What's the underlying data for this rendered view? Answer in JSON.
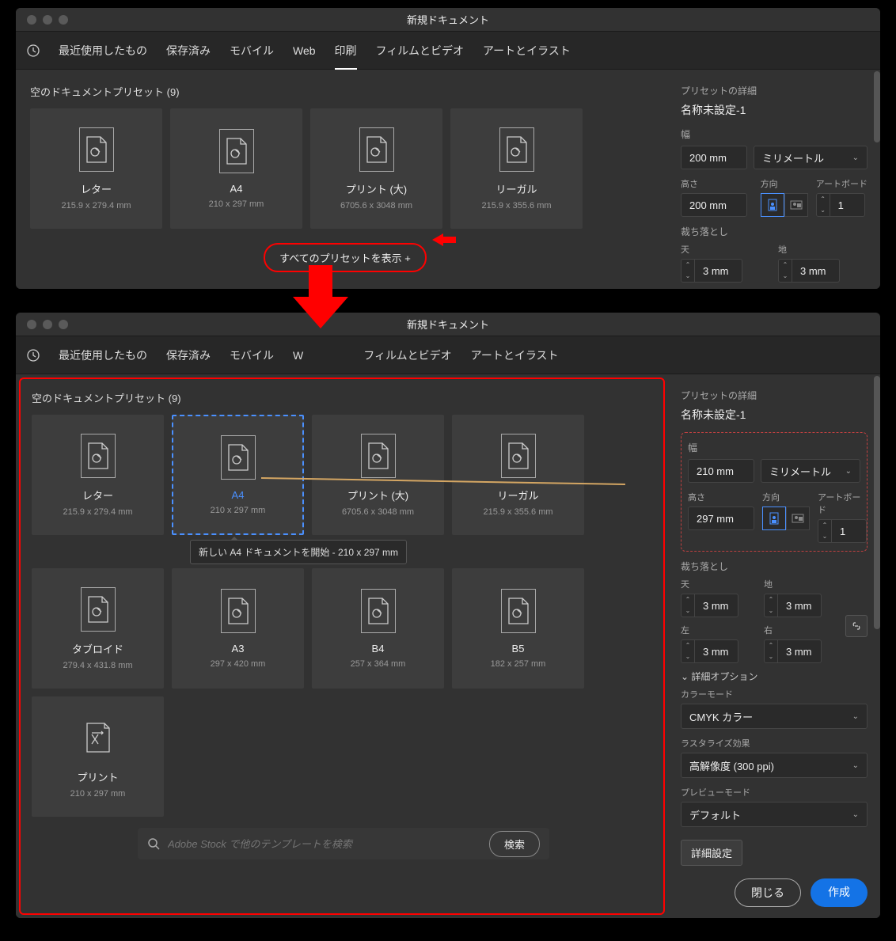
{
  "tabs": {
    "recent": "最近使用したもの",
    "saved": "保存済み",
    "mobile": "モバイル",
    "web": "Web",
    "print": "印刷",
    "film": "フィルムとビデオ",
    "art": "アートとイラスト"
  },
  "dialog1": {
    "title": "新規ドキュメント",
    "section_title": "空のドキュメントプリセット",
    "preset_count": "(9)",
    "presets": [
      {
        "name": "レター",
        "size": "215.9 x 279.4 mm"
      },
      {
        "name": "A4",
        "size": "210 x 297 mm"
      },
      {
        "name": "プリント (大)",
        "size": "6705.6 x 3048 mm"
      },
      {
        "name": "リーガル",
        "size": "215.9 x 355.6 mm"
      }
    ],
    "show_all_label": "すべてのプリセットを表示 +",
    "right": {
      "header": "プリセットの詳細",
      "preset_name": "名称未設定-1",
      "width_label": "幅",
      "width_value": "200 mm",
      "unit_value": "ミリメートル",
      "height_label": "高さ",
      "height_value": "200 mm",
      "orient_label": "方向",
      "artboard_label": "アートボード",
      "artboard_value": "1",
      "bleed_label": "裁ち落とし",
      "bleed_top_label": "天",
      "bleed_top": "3 mm",
      "bleed_bottom_label": "地",
      "bleed_bottom": "3 mm"
    }
  },
  "dialog2": {
    "title": "新規ドキュメント",
    "section_title": "空のドキュメントプリセット",
    "preset_count": "(9)",
    "presets_row1": [
      {
        "name": "レター",
        "size": "215.9 x 279.4 mm"
      },
      {
        "name": "A4",
        "size": "210 x 297 mm",
        "selected": true
      },
      {
        "name": "プリント (大)",
        "size": "6705.6 x 3048 mm"
      },
      {
        "name": "リーガル",
        "size": "215.9 x 355.6 mm"
      }
    ],
    "presets_row2": [
      {
        "name": "タブロイド",
        "size": "279.4 x 431.8 mm"
      },
      {
        "name": "A3",
        "size": "297 x 420 mm"
      },
      {
        "name": "B4",
        "size": "257 x 364 mm"
      },
      {
        "name": "B5",
        "size": "182 x 257 mm"
      }
    ],
    "presets_row3": [
      {
        "name": "プリント",
        "size": "210 x 297 mm",
        "icon": "print"
      }
    ],
    "tooltip": "新しい A4 ドキュメントを開始 - 210 x 297 mm",
    "search_placeholder": "Adobe Stock で他のテンプレートを検索",
    "search_btn": "検索",
    "right": {
      "header": "プリセットの詳細",
      "preset_name": "名称未設定-1",
      "width_label": "幅",
      "width_value": "210 mm",
      "unit_value": "ミリメートル",
      "height_label": "高さ",
      "height_value": "297 mm",
      "orient_label": "方向",
      "artboard_label": "アートボード",
      "artboard_value": "1",
      "bleed_label": "裁ち落とし",
      "bleed_top_label": "天",
      "bleed_top": "3 mm",
      "bleed_bottom_label": "地",
      "bleed_bottom": "3 mm",
      "bleed_left_label": "左",
      "bleed_left": "3 mm",
      "bleed_right_label": "右",
      "bleed_right": "3 mm",
      "advanced_label": "詳細オプション",
      "color_mode_label": "カラーモード",
      "color_mode_value": "CMYK カラー",
      "raster_label": "ラスタライズ効果",
      "raster_value": "高解像度 (300 ppi)",
      "preview_label": "プレビューモード",
      "preview_value": "デフォルト",
      "detail_btn": "詳細設定",
      "close_btn": "閉じる",
      "create_btn": "作成"
    }
  }
}
